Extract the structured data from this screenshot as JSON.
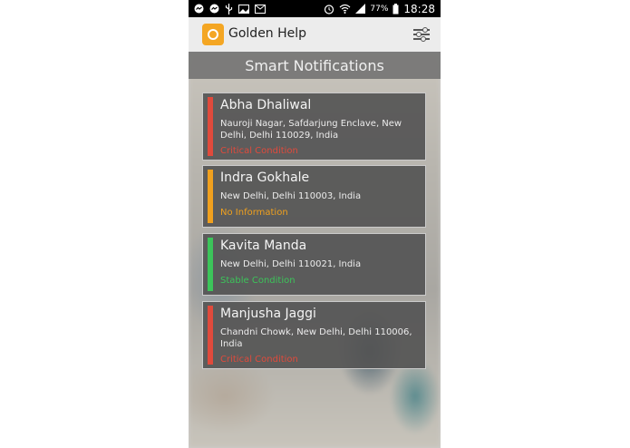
{
  "status_bar": {
    "battery_percent": "77%",
    "time": "18:28"
  },
  "app_bar": {
    "title": "Golden Help",
    "logo_icon": "golden-help-logo",
    "settings_icon": "sliders-icon"
  },
  "header": {
    "title": "Smart Notifications"
  },
  "notifications": [
    {
      "name": "Abha Dhaliwal",
      "address": "Nauroji Nagar, Safdarjung Enclave, New Delhi, Delhi 110029, India",
      "status": "Critical Condition",
      "color": "#e04a3c"
    },
    {
      "name": "Indra Gokhale",
      "address": "New Delhi, Delhi 110003, India",
      "status": "No Information",
      "color": "#f0a01e"
    },
    {
      "name": "Kavita Manda",
      "address": "New Delhi, Delhi 110021, India",
      "status": "Stable Condition",
      "color": "#3cc45a"
    },
    {
      "name": "Manjusha Jaggi",
      "address": "Chandni Chowk, New Delhi, Delhi 110006, India",
      "status": "Critical Condition",
      "color": "#e04a3c"
    }
  ]
}
